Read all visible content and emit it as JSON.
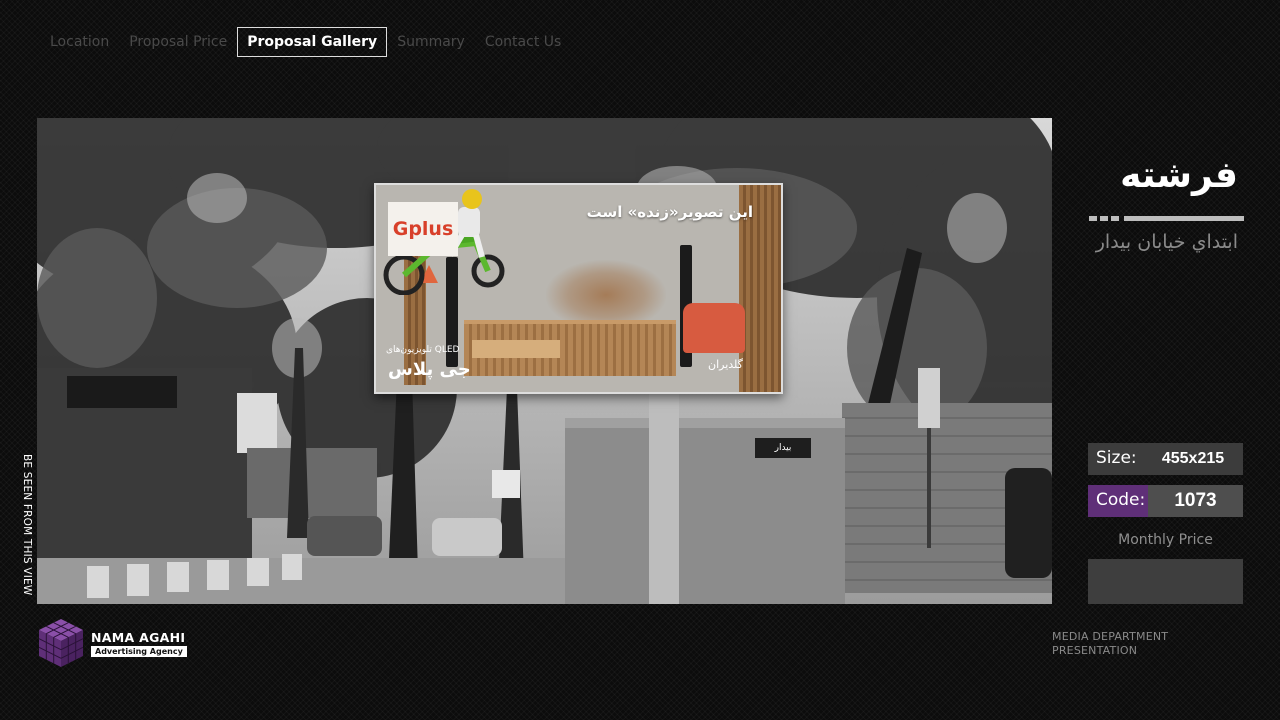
{
  "nav": {
    "items": [
      {
        "label": "Location"
      },
      {
        "label": "Proposal Price"
      },
      {
        "label": "Proposal Gallery"
      },
      {
        "label": "Summary"
      },
      {
        "label": "Contact Us"
      }
    ]
  },
  "photo": {
    "billboard": {
      "brand_logo": "Gplus",
      "headline": "این تصویر«زنده» است",
      "product_line": "تلویزیون‌های QLED",
      "product_name": "جی پلاس",
      "secondary_brand": "گلدیران"
    },
    "street_sign": "بیدار",
    "side_caption": "BE SEEN FROM THIS VIEW"
  },
  "location": {
    "title": "فرشته",
    "subtitle": "ابتداي خيابان بيدار"
  },
  "specs": {
    "size_label": "Size:",
    "size_value": "455x215",
    "code_label": "Code:",
    "code_value": "1073",
    "monthly_price_label": "Monthly Price",
    "monthly_price_value": ""
  },
  "brand": {
    "name": "NAMA AGAHI",
    "tagline": "Advertising Agency"
  },
  "footer": {
    "line1": "MEDIA DEPARTMENT",
    "line2": "PRESENTATION"
  },
  "colors": {
    "accent_purple": "#5f2f78",
    "panel_gray": "#3c3c3c",
    "background": "#0c0c0c"
  }
}
